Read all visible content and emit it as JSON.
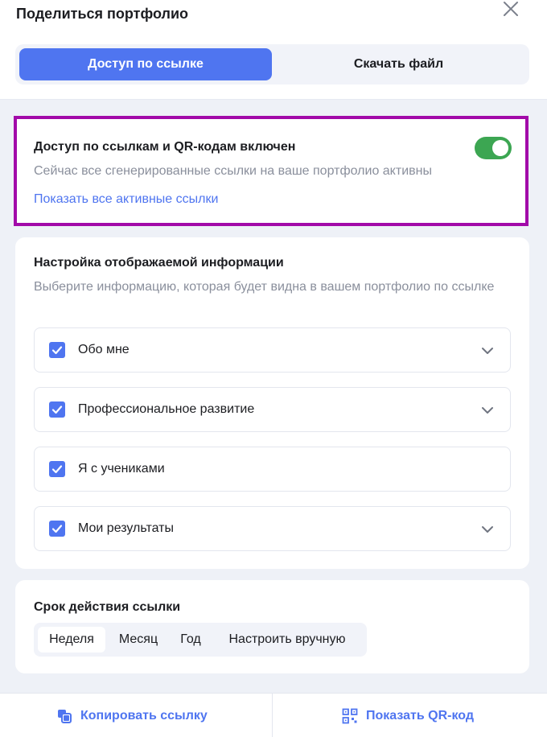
{
  "modal": {
    "title": "Поделиться портфолио",
    "close_icon": "close-icon"
  },
  "tabs": [
    {
      "label": "Доступ по ссылке",
      "active": true
    },
    {
      "label": "Скачать файл",
      "active": false
    }
  ],
  "access": {
    "title": "Доступ по ссылкам и QR-кодам включен",
    "description": "Сейчас все сгенерированные ссылки на ваше портфолио активны",
    "link": "Показать все активные ссылки",
    "toggle_on": true
  },
  "info": {
    "title": "Настройка отображаемой информации",
    "description": "Выберите информацию, которая будет видна в вашем портфолио по ссылке",
    "sections": [
      {
        "label": "Обо мне",
        "checked": true,
        "expandable": true
      },
      {
        "label": "Профессиональное развитие",
        "checked": true,
        "expandable": true
      },
      {
        "label": "Я с учениками",
        "checked": true,
        "expandable": false
      },
      {
        "label": "Мои результаты",
        "checked": true,
        "expandable": true
      }
    ]
  },
  "expiry": {
    "title": "Срок действия ссылки",
    "options": [
      {
        "label": "Неделя",
        "active": true
      },
      {
        "label": "Месяц",
        "active": false
      },
      {
        "label": "Год",
        "active": false
      },
      {
        "label": "Настроить вручную",
        "active": false
      }
    ]
  },
  "footer": {
    "copy_label": "Копировать ссылку",
    "copy_icon": "copy-icon",
    "qr_label": "Показать QR-код",
    "qr_icon": "qr-code-icon"
  },
  "colors": {
    "accent": "#4f75f0",
    "toggle_on": "#3ca652",
    "highlight_border": "#a20aa9",
    "panel_background": "#eef1f7"
  }
}
